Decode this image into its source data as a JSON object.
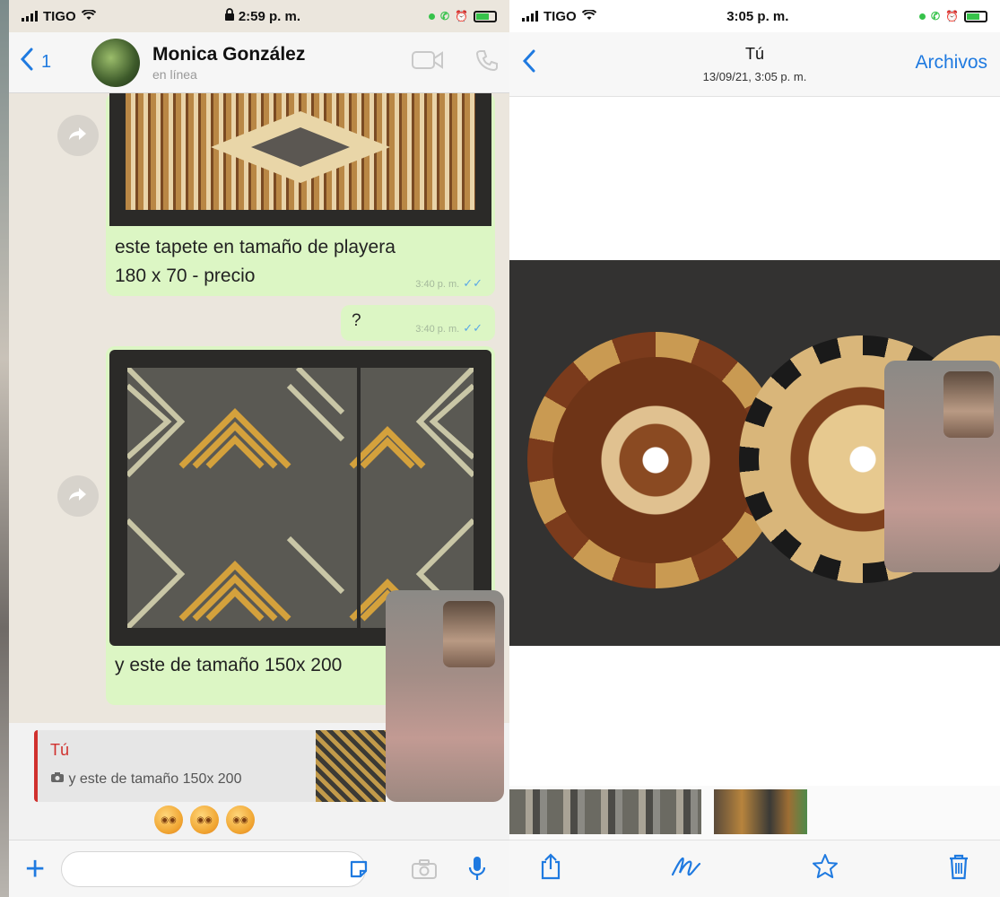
{
  "left_phone": {
    "status_bar": {
      "carrier": "TIGO",
      "time": "2:59 p. m."
    },
    "header": {
      "back_count": "1",
      "contact_name": "Monica González",
      "contact_status": "en línea"
    },
    "messages": [
      {
        "caption_line1": "este tapete en tamaño de playera",
        "caption_line2": "180 x 70 - precio",
        "time": "3:40 p. m."
      },
      {
        "text": "?",
        "time": "3:40 p. m."
      },
      {
        "caption": "y este de tamaño 150x 200"
      }
    ],
    "reply": {
      "author": "Tú",
      "text": "y este de tamaño 150x 200"
    },
    "input": {
      "placeholder": ""
    }
  },
  "right_phone": {
    "status_bar": {
      "carrier": "TIGO",
      "time": "3:05 p. m."
    },
    "header": {
      "title": "Tú",
      "date": "13/09/21, 3:05 p. m.",
      "files_label": "Archivos"
    }
  },
  "colors": {
    "accent": "#1f7ae0",
    "outgoing_bubble": "#dcf6c4",
    "reply_author": "#d0302d",
    "battery": "#36c24a"
  },
  "icons": [
    "back-chevron-icon",
    "video-call-icon",
    "phone-icon",
    "forward-icon",
    "camera-icon",
    "sticker-icon",
    "microphone-icon",
    "plus-icon",
    "share-icon",
    "draw-icon",
    "star-icon",
    "trash-icon"
  ]
}
